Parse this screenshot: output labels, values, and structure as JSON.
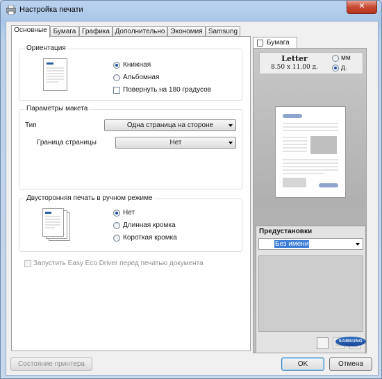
{
  "window": {
    "title": "Настройка печати",
    "close_label": "✕"
  },
  "tabs": [
    "Основные",
    "Бумага",
    "Графика",
    "Дополнительно",
    "Экономия",
    "Samsung"
  ],
  "orientation": {
    "title": "Ориентация",
    "options": [
      "Книжная",
      "Альбомная"
    ],
    "selected": "Книжная",
    "rotate_label": "Повернуть на 180 градусов"
  },
  "layout": {
    "title": "Параметры макета",
    "type_label": "Тип",
    "type_value": "Одна страница на стороне",
    "border_label": "Граница страницы",
    "border_value": "Нет"
  },
  "duplex": {
    "title": "Двусторонняя печать в ручном режиме",
    "options": [
      "Нет",
      "Длинная кромка",
      "Короткая кромка"
    ],
    "selected": "Нет"
  },
  "eco_driver_label": "Запустить Easy Eco Driver перед печатью документа",
  "preview": {
    "tab_label": "Бумага",
    "paper_name": "Letter",
    "paper_size": "8.50 x 11.00 д.",
    "units": [
      "мм",
      "д."
    ],
    "units_selected": "д."
  },
  "presets": {
    "title": "Предустановки",
    "value": "Без имени"
  },
  "brand": "SAMSUNG",
  "buttons": {
    "printer_status": "Состояние принтера",
    "ok": "OK",
    "cancel": "Отмена"
  }
}
